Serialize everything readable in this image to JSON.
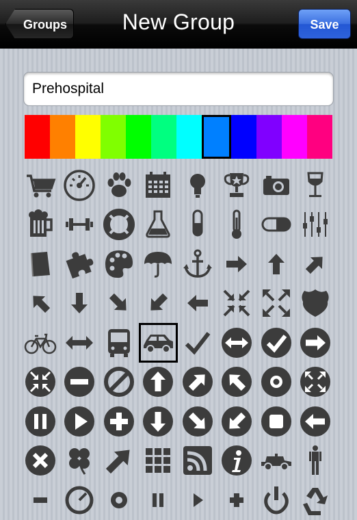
{
  "nav": {
    "back_label": "Groups",
    "title": "New Group",
    "save_label": "Save"
  },
  "group_name": {
    "value": "Prehospital"
  },
  "colors": {
    "swatches": [
      "#ff0000",
      "#ff8000",
      "#ffff00",
      "#80ff00",
      "#00ff00",
      "#00ff80",
      "#00ffff",
      "#0080ff",
      "#0000ff",
      "#8000ff",
      "#ff00ff",
      "#ff0080"
    ],
    "selected_index": 7
  },
  "icons": {
    "selected_index": 35,
    "items": [
      "shopping-cart",
      "speedometer",
      "paw",
      "calendar",
      "lightbulb",
      "trophy",
      "camera",
      "wine-glass",
      "beer-mug",
      "dumbbell",
      "lifebuoy",
      "flask",
      "test-tube",
      "thermometer",
      "pill",
      "equalizer",
      "book",
      "puzzle",
      "palette",
      "umbrella",
      "anchor",
      "arrow-right",
      "arrow-up",
      "arrow-up-right",
      "arrow-up-left",
      "arrow-down",
      "arrow-down-right",
      "arrow-down-left",
      "arrow-left",
      "compress",
      "expand",
      "shield",
      "bicycle",
      "arrows-horizontal",
      "bus",
      "car",
      "check",
      "circle-arrows-horizontal",
      "circle-check",
      "circle-arrow-right",
      "circle-compress",
      "circle-minus",
      "circle-slash",
      "circle-arrow-up",
      "circle-arrow-up-right",
      "circle-arrow-up-left",
      "circle-target",
      "circle-expand",
      "circle-pause",
      "circle-play",
      "circle-plus",
      "circle-arrow-down",
      "circle-arrow-down-right",
      "circle-arrow-down-left",
      "circle-stop",
      "circle-arrow-left",
      "circle-x",
      "clover",
      "arrow-large",
      "grid",
      "rss",
      "info",
      "jeep",
      "person",
      "minus",
      "gauge",
      "location",
      "pause",
      "play",
      "plus",
      "power",
      "recycle"
    ]
  }
}
